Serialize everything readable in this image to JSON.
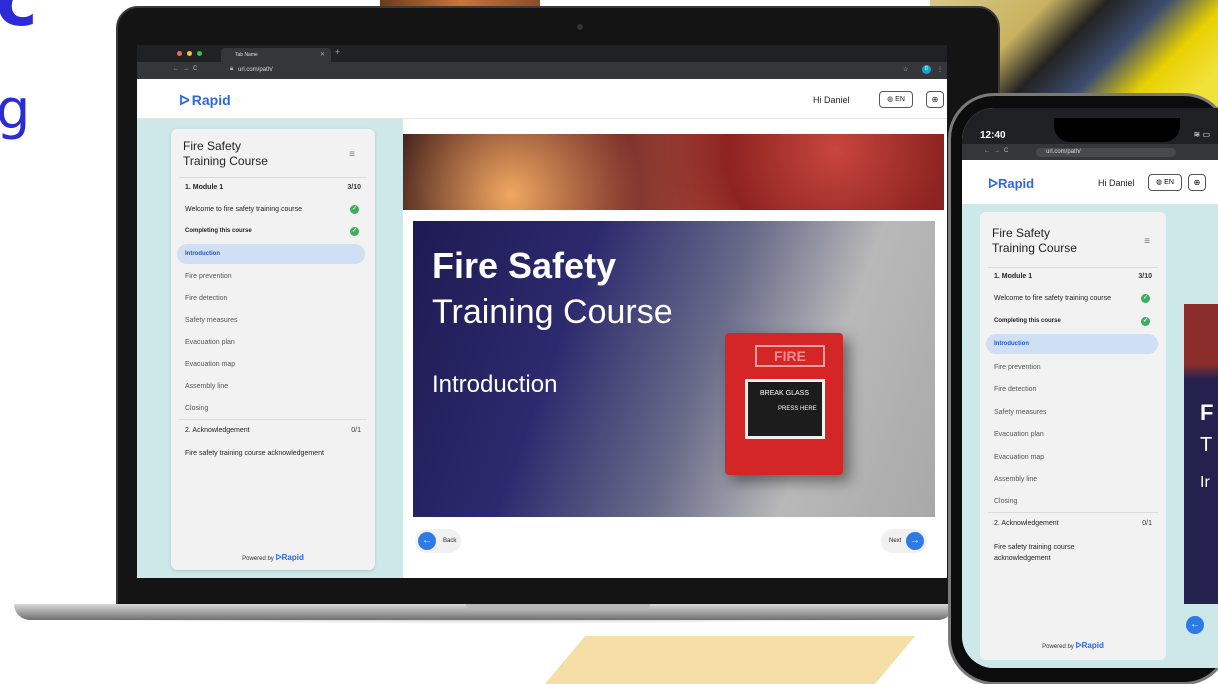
{
  "browser": {
    "tab_name": "Tab Name",
    "url": "url.com/path/",
    "profile_initial": "D"
  },
  "header": {
    "brand": "Rapid",
    "greeting": "Hi Daniel",
    "lang": "EN"
  },
  "sidebar": {
    "title_line1": "Fire Safety",
    "title_line2": "Training Course",
    "module1": {
      "label": "1. Module 1",
      "progress": "3/10"
    },
    "items": [
      {
        "label": "Welcome to fire safety training course",
        "done": true
      },
      {
        "label": "Completing this course",
        "done": true
      },
      {
        "label": "Introduction",
        "active": true
      },
      {
        "label": "Fire prevention"
      },
      {
        "label": "Fire detection"
      },
      {
        "label": "Safety measures"
      },
      {
        "label": "Evacuation plan"
      },
      {
        "label": "Evacuation map"
      },
      {
        "label": "Assembly line"
      },
      {
        "label": "Closing"
      }
    ],
    "module2": {
      "label": "2. Acknowledgement",
      "progress": "0/1"
    },
    "module2_item": "Fire safety training course acknowledgement",
    "module2_item_line1": "Fire safety training course",
    "module2_item_line2": "acknowledgement",
    "powered_by": "Powered by",
    "powered_brand": "Rapid"
  },
  "slide": {
    "title": "Fire Safety",
    "subtitle": "Training Course",
    "section": "Introduction",
    "alarm_fire": "FIRE",
    "alarm_break": "BREAK GLASS",
    "alarm_press": "PRESS HERE"
  },
  "nav": {
    "back": "Back",
    "next": "Next"
  },
  "phone": {
    "time": "12:40"
  },
  "colors": {
    "brand": "#2e66e6",
    "body_bg": "#cde8e8",
    "active_item": "#cfe0f5",
    "check": "#3dae5b"
  }
}
